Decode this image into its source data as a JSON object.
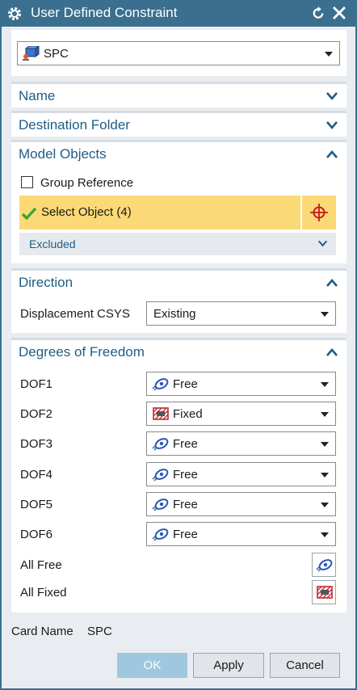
{
  "window": {
    "title": "User Defined Constraint"
  },
  "type_selector": {
    "value": "SPC"
  },
  "sections": {
    "name": {
      "label": "Name"
    },
    "destination_folder": {
      "label": "Destination Folder"
    },
    "model_objects": {
      "label": "Model Objects",
      "group_reference_label": "Group Reference",
      "group_reference_checked": false,
      "select_object_label": "Select Object (4)",
      "excluded_label": "Excluded"
    },
    "direction": {
      "label": "Direction",
      "displacement_csys_label": "Displacement CSYS",
      "displacement_csys_value": "Existing"
    },
    "degrees_of_freedom": {
      "label": "Degrees of Freedom",
      "dofs": [
        {
          "label": "DOF1",
          "value": "Free",
          "icon": "free-icon"
        },
        {
          "label": "DOF2",
          "value": "Fixed",
          "icon": "fixed-icon"
        },
        {
          "label": "DOF3",
          "value": "Free",
          "icon": "free-icon"
        },
        {
          "label": "DOF4",
          "value": "Free",
          "icon": "free-icon"
        },
        {
          "label": "DOF5",
          "value": "Free",
          "icon": "free-icon"
        },
        {
          "label": "DOF6",
          "value": "Free",
          "icon": "free-icon"
        }
      ],
      "all_free_label": "All Free",
      "all_fixed_label": "All Fixed"
    }
  },
  "card_name": {
    "label": "Card Name",
    "value": "SPC"
  },
  "buttons": {
    "ok": "OK",
    "apply": "Apply",
    "cancel": "Cancel"
  },
  "colors": {
    "title_bar": "#3a6f8f",
    "section_label": "#1e5d86",
    "selected_row": "#fbd976",
    "ok_button": "#9fc7dd"
  }
}
